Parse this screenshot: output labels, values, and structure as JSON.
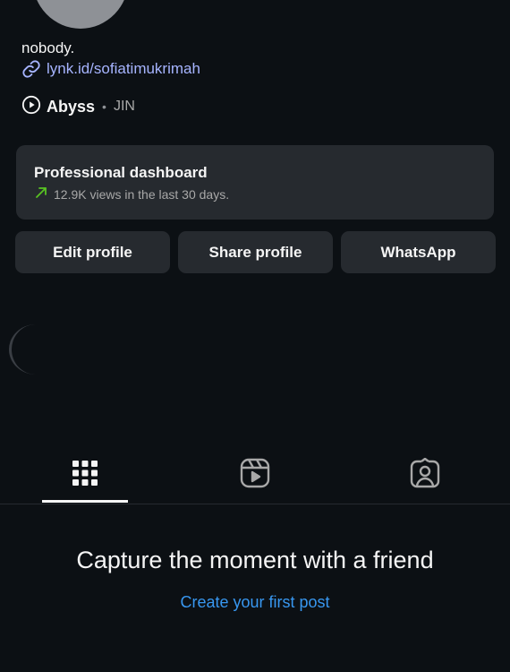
{
  "profile": {
    "bio": "nobody.",
    "link": "lynk.id/sofiatimukrimah"
  },
  "music": {
    "title": "Abyss",
    "separator": "•",
    "artist": "JIN"
  },
  "dashboard": {
    "title": "Professional dashboard",
    "stat": "12.9K views in the last 30 days.",
    "trend_color": "#58c322"
  },
  "buttons": {
    "edit": "Edit profile",
    "share": "Share profile",
    "whatsapp": "WhatsApp"
  },
  "tabs": [
    {
      "icon": "grid-icon",
      "selected": true
    },
    {
      "icon": "reels-icon",
      "selected": false
    },
    {
      "icon": "tagged-icon",
      "selected": false
    }
  ],
  "empty_state": {
    "title": "Capture the moment with a friend",
    "action": "Create your first post"
  },
  "colors": {
    "background": "#0c1014",
    "surface": "#262a2f",
    "link": "#a6b4ff",
    "accent": "#3897f0"
  }
}
